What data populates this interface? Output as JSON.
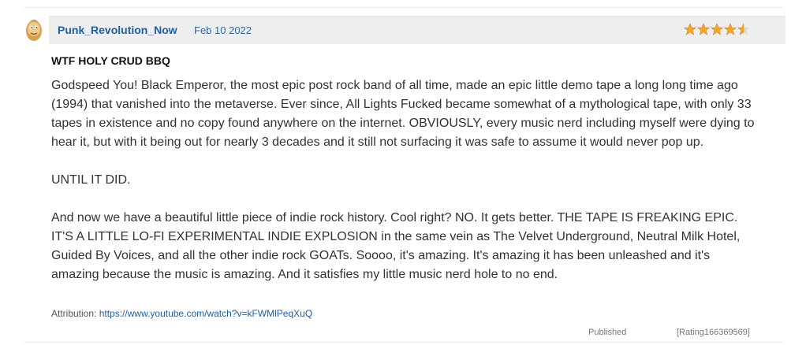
{
  "review": {
    "username": "Punk_Revolution_Now",
    "date": "Feb 10 2022",
    "rating": 4.5,
    "rating_max": 5,
    "star_color": "#f5a623",
    "title": "WTF HOLY CRUD BBQ",
    "paragraphs": [
      "Godspeed You! Black Emperor, the most epic post rock band of all time, made an epic little demo tape a long long time ago (1994) that vanished into the metaverse. Ever since, All Lights Fucked became somewhat of a mythological tape, with only 33 tapes in existence and no copy found anywhere on the internet. OBVIOUSLY, every music nerd including myself were dying to hear it, but with it being out for nearly 3 decades and it still not surfacing it was safe to assume it would never pop up.",
      "UNTIL IT DID.",
      "And now we have a beautiful little piece of indie rock history. Cool right? NO. It gets better. THE TAPE IS FREAKING EPIC. IT'S A LITTLE LO-FI EXPERIMENTAL INDIE EXPLOSION in the same vein as The Velvet Underground, Neutral Milk Hotel, Guided By Voices, and all the other indie rock GOATs. Soooo, it's amazing. It's amazing it has been unleashed and it's amazing because the music is amazing. And it satisfies my little music nerd hole to no end."
    ],
    "attribution_label": "Attribution:",
    "attribution_url": "https://www.youtube.com/watch?v=kFWMlPeqXuQ",
    "status": "Published",
    "rating_id": "[Rating166369569]"
  }
}
